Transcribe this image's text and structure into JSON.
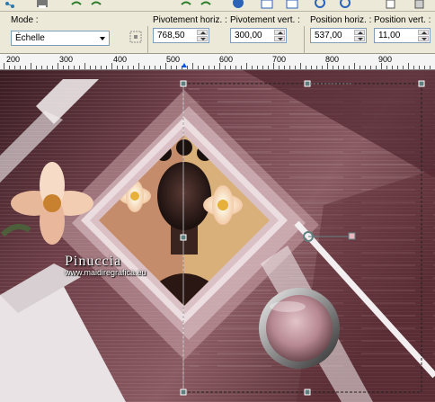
{
  "toolbar": {
    "icons": [
      "share-icon",
      "print-icon",
      "undo-icon",
      "redo-icon",
      "help-icon",
      "grid-icon",
      "selection-icon",
      "zoom-in-icon",
      "zoom-out-icon",
      "copy-icon"
    ]
  },
  "properties": {
    "mode_label": "Mode :",
    "mode_value": "Échelle",
    "pivot_h_label": "Pivotement horiz. :",
    "pivot_h_value": "768,50",
    "pivot_v_label": "Pivotement vert. :",
    "pivot_v_value": "300,00",
    "pos_h_label": "Position horiz. :",
    "pos_h_value": "537,00",
    "pos_v_label": "Position vert. :",
    "pos_v_value": "11,00"
  },
  "ruler": {
    "labels": [
      "200",
      "300",
      "400",
      "500",
      "600",
      "700",
      "800",
      "900"
    ]
  },
  "canvas": {
    "watermark_name": "Pinuccia",
    "watermark_url": "www.maidiregrafica.eu",
    "colors": {
      "dark": "#3a1c22",
      "mauve": "#8a5a62",
      "rose": "#c9a3a8",
      "light": "#efe4e6",
      "selection_handle": "#5f7f7f"
    }
  }
}
